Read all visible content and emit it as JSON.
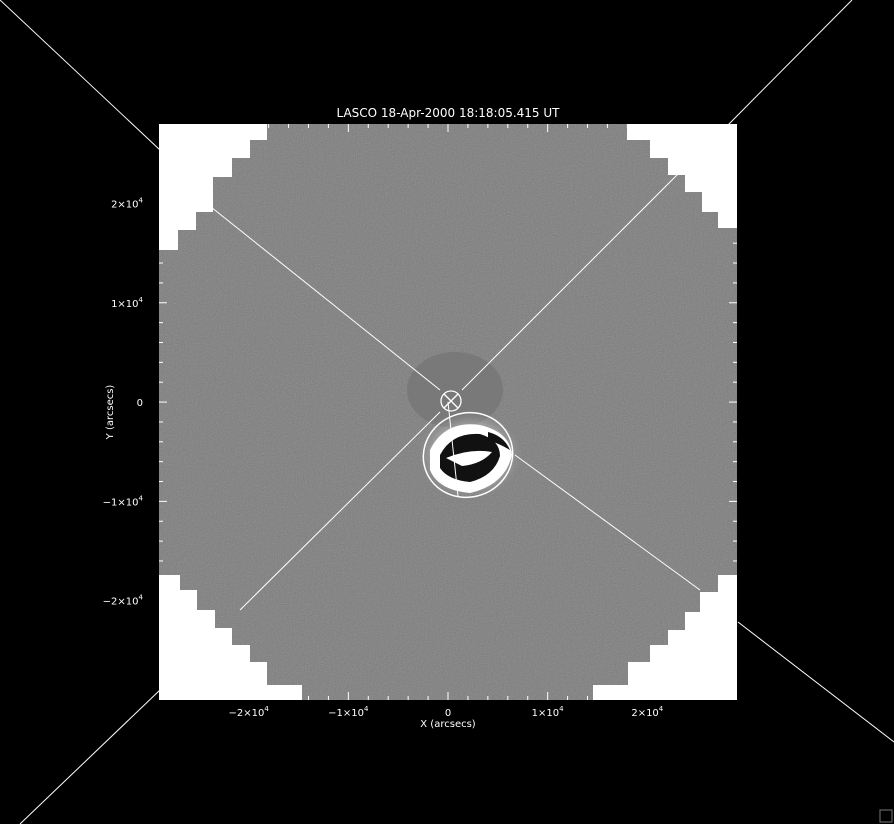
{
  "plot": {
    "title": "LASCO  18-Apr-2000 18:18:05.415 UT",
    "xlabel": "X (arcsecs)",
    "ylabel": "Y (arcsecs)",
    "xticks": [
      {
        "value": -20000,
        "mantissa": "−2×10",
        "exp": "4"
      },
      {
        "value": -10000,
        "mantissa": "−1×10",
        "exp": "4"
      },
      {
        "value": 0,
        "mantissa": "0",
        "exp": ""
      },
      {
        "value": 10000,
        "mantissa": "1×10",
        "exp": "4"
      },
      {
        "value": 20000,
        "mantissa": "2×10",
        "exp": "4"
      }
    ],
    "yticks": [
      {
        "value": 20000,
        "mantissa": "2×10",
        "exp": "4"
      },
      {
        "value": 10000,
        "mantissa": "1×10",
        "exp": "4"
      },
      {
        "value": 0,
        "mantissa": "0",
        "exp": ""
      },
      {
        "value": -10000,
        "mantissa": "−1×10",
        "exp": "4"
      },
      {
        "value": -20000,
        "mantissa": "−2×10",
        "exp": "4"
      }
    ],
    "xlim": [
      -29000,
      29000
    ],
    "ylim": [
      -30000,
      28000
    ]
  },
  "colors": {
    "background": "#000000",
    "field": "#7b7b7b",
    "corner_fill": "#ffffff",
    "lines": "#ffffff",
    "text": "#ffffff"
  }
}
